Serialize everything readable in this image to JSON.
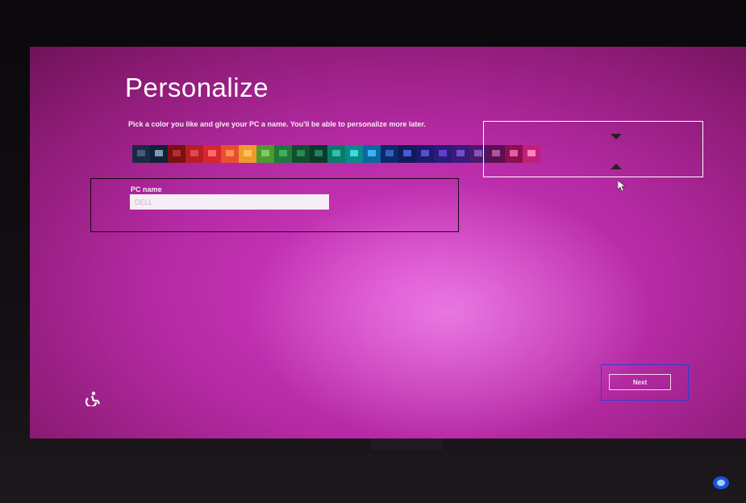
{
  "screen": {
    "title": "Personalize",
    "subtitle": "Pick a color you like and give your PC a name. You'll be able to personalize more later.",
    "pc_name_label": "PC name",
    "pc_name_value": "DELL",
    "next_label": "Next"
  },
  "palette": {
    "swatches": [
      {
        "outer": "#1a2a44",
        "inner": "#4a5a7a"
      },
      {
        "outer": "#0f2238",
        "inner": "#7f98b6"
      },
      {
        "outer": "#7a1010",
        "inner": "#b23030"
      },
      {
        "outer": "#b81d24",
        "inner": "#e04848"
      },
      {
        "outer": "#d8262e",
        "inner": "#ff6a6a"
      },
      {
        "outer": "#e7502d",
        "inner": "#ff8a5a"
      },
      {
        "outer": "#f09a2a",
        "inner": "#ffc060"
      },
      {
        "outer": "#4e9a30",
        "inner": "#80cc60"
      },
      {
        "outer": "#1e7a3a",
        "inner": "#40b060"
      },
      {
        "outer": "#0f4f2f",
        "inner": "#2a8a4a"
      },
      {
        "outer": "#0c3a2a",
        "inner": "#208060"
      },
      {
        "outer": "#0c7a6a",
        "inner": "#30c0a8"
      },
      {
        "outer": "#0a8a8a",
        "inner": "#40d8d8"
      },
      {
        "outer": "#0a6aa0",
        "inner": "#40b0f0"
      },
      {
        "outer": "#0a2a6a",
        "inner": "#3060c0"
      },
      {
        "outer": "#101a5a",
        "inner": "#4060d0"
      },
      {
        "outer": "#1c1a6a",
        "inner": "#5050d0"
      },
      {
        "outer": "#2a1a7a",
        "inner": "#6040d0"
      },
      {
        "outer": "#3a1a7a",
        "inner": "#7050c8"
      },
      {
        "outer": "#4a1a6a",
        "inner": "#8a50c0"
      },
      {
        "outer": "#5a1050",
        "inner": "#b050a0"
      },
      {
        "outer": "#8a1050",
        "inner": "#e060a0"
      },
      {
        "outer": "#c0207a",
        "inner": "#ff80c0"
      }
    ],
    "selected_index": 21
  },
  "colors": {
    "accent_background": "#b52aa4",
    "annotation_color_picker": "#ffffff",
    "annotation_name_field": "#1a0812",
    "annotation_next_button": "#2c3fcf"
  },
  "icons": {
    "accessibility": "ease-of-access-icon",
    "cursor": "mouse-pointer-icon",
    "tray": "tray-light-icon"
  }
}
